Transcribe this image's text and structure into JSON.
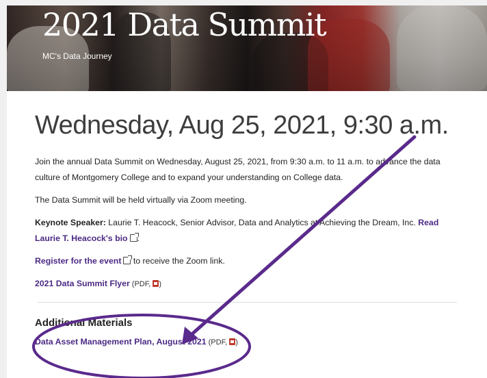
{
  "hero": {
    "title": "2021 Data Summit",
    "subtitle": "MC's Data Journey"
  },
  "event": {
    "date_heading": "Wednesday, Aug 25, 2021, 9:30 a.m.",
    "intro": "Join the annual Data Summit on Wednesday, August 25, 2021, from 9:30 a.m. to 11 a.m. to advance the data culture of Montgomery College and to expand your understanding on College data.",
    "zoom_note": "The Data Summit will be held virtually via Zoom meeting.",
    "keynote_label": "Keynote Speaker:",
    "keynote_text": " Laurie T. Heacock, Senior Advisor, Data and Analytics at Achieving the Dream, Inc. ",
    "keynote_link": "Read Laurie T. Heacock's bio",
    "register_link": "Register for the event",
    "register_text": " to receive the Zoom link.",
    "flyer_link": "2021 Data Summit Flyer",
    "flyer_meta": " (PDF, "
  },
  "additional": {
    "heading": "Additional Materials",
    "items": [
      {
        "link": "Data Asset Management Plan, August 2021",
        "meta": " (PDF, "
      }
    ]
  },
  "colors": {
    "link": "#4b2a84",
    "annotation": "#5a2a8c"
  },
  "icons": {
    "external": "external-link-icon",
    "pdf": "pdf-icon"
  }
}
